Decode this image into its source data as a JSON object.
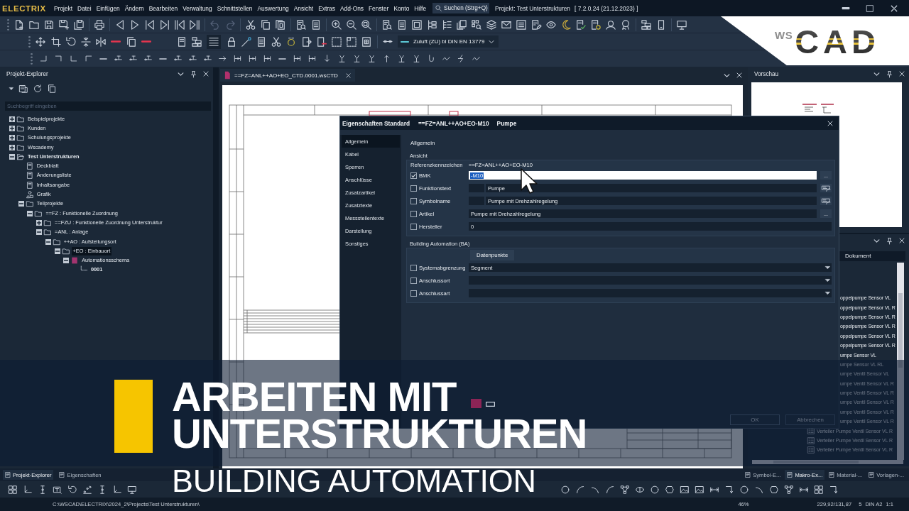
{
  "app": {
    "logo": "ELECTRIX",
    "menu": [
      "Projekt",
      "Datei",
      "Einfügen",
      "Ändern",
      "Bearbeiten",
      "Verwaltung",
      "Schnittstellen",
      "Auswertung",
      "Ansicht",
      "Extras",
      "Add-Ons",
      "Fenster",
      "Konto",
      "Hilfe"
    ],
    "search": {
      "placeholder": "Suchen (Strg+Q)"
    },
    "project_title": "Projekt: Test Unterstrukturen",
    "version": "[ 7.2.0.24 (21.12.2023) ]"
  },
  "toolbar": {
    "history": [
      {
        "kind": "undo",
        "disabled": true
      },
      {
        "kind": "redo",
        "disabled": true
      }
    ],
    "line_view": {
      "pressed": true
    },
    "medium": "Zuluft (ZU) bl DIN EN 13779"
  },
  "brand_logo": {
    "prefix": "WS",
    "wordmark": "CAD"
  },
  "explorer": {
    "title": "Projekt-Explorer",
    "search": {
      "placeholder": "Suchbegriff eingeben"
    },
    "tree": [
      {
        "label": "Beispielprojekte",
        "kind": "folder",
        "expanded": false,
        "selected": false,
        "active": false
      },
      {
        "label": "Kunden",
        "kind": "folder",
        "expanded": false,
        "selected": false,
        "active": false
      },
      {
        "label": "Schulungsprojekte",
        "kind": "folder",
        "expanded": false,
        "selected": false,
        "active": false
      },
      {
        "label": "Wscademy",
        "kind": "folder",
        "expanded": false,
        "selected": false,
        "active": false
      },
      {
        "label": "Test Unterstrukturen",
        "kind": "project",
        "expanded": true,
        "selected": false,
        "active": true,
        "children": [
          {
            "label": "Deckblatt",
            "kind": "page",
            "selected": false,
            "active": false
          },
          {
            "label": "Änderungsliste",
            "kind": "page",
            "selected": false,
            "active": false
          },
          {
            "label": "Inhaltsangabe",
            "kind": "page",
            "selected": false,
            "active": false
          },
          {
            "label": "Grafik",
            "kind": "graphic",
            "selected": false,
            "active": false
          },
          {
            "label": "Teilprojekte",
            "kind": "folder",
            "expanded": true,
            "selected": false,
            "active": false,
            "children": [
              {
                "label": "==FZ : Funktionelle Zuordnung",
                "kind": "folder",
                "expanded": true,
                "selected": false,
                "active": false,
                "children": [
                  {
                    "label": "==FZU : Funktionelle Zuordnung Unterstruktur",
                    "kind": "folder",
                    "expanded": false,
                    "selected": false,
                    "active": false
                  },
                  {
                    "label": "=ANL : Anlage",
                    "kind": "folder",
                    "expanded": true,
                    "selected": false,
                    "active": false,
                    "children": [
                      {
                        "label": "++AO : Aufstellungsort",
                        "kind": "folder",
                        "expanded": true,
                        "selected": false,
                        "active": false,
                        "children": [
                          {
                            "label": "+EO : Einbauort",
                            "kind": "folder",
                            "expanded": true,
                            "selected": true,
                            "active": false,
                            "children": [
                              {
                                "label": "Automationsschema",
                                "kind": "schema",
                                "expanded": true,
                                "selected": false,
                                "active": false,
                                "children": [
                                  {
                                    "label": "0001",
                                    "kind": "sheet",
                                    "selected": false,
                                    "active": true
                                  }
                                ]
                              }
                            ]
                          }
                        ]
                      }
                    ]
                  }
                ]
              }
            ]
          }
        ]
      }
    ]
  },
  "document": {
    "tab": "==FZ=ANL++AO+EO_CTD.0001.wsCTD"
  },
  "preview": {
    "title": "Vorschau"
  },
  "macro_panel": {
    "column": "Dokument",
    "items": [
      {
        "kind": "bare",
        "label": "oppelpumpe Sensor VL"
      },
      {
        "kind": "bare",
        "label": "oppelpumpe Sensor VL R"
      },
      {
        "kind": "bare",
        "label": "oppelpumpe Sensor VL R"
      },
      {
        "kind": "bare",
        "label": "oppelpumpe Sensor VL R"
      },
      {
        "kind": "bare",
        "label": "oppelpumpe Sensor VL R"
      },
      {
        "kind": "bare",
        "label": "oppelpumpe Sensor VL R"
      },
      {
        "kind": "bare",
        "label": "umpe Sensor VL"
      },
      {
        "kind": "bare",
        "label": "umpe Sensor VL RL"
      },
      {
        "kind": "bare",
        "label": "umpe Ventil Sensor VL"
      },
      {
        "kind": "bare",
        "label": "umpe Ventil Sensor VL R"
      },
      {
        "kind": "bare",
        "label": "umpe Ventil Sensor VL R"
      },
      {
        "kind": "bare",
        "label": "umpe Ventil Sensor VL R"
      },
      {
        "kind": "bare",
        "label": "umpe Ventil Sensor VL R"
      },
      {
        "kind": "bare",
        "label": "umpe Ventil Sensor VL R"
      },
      {
        "kind": "icon",
        "label": "Verteiler Pumpe Ventil Sensor VL R"
      },
      {
        "kind": "icon",
        "label": "Verteiler Pumpe Ventil Sensor VL R"
      },
      {
        "kind": "icon",
        "label": "Verteiler Pumpe Ventil Sensor VL R"
      }
    ]
  },
  "dialog": {
    "title": "Eigenschaften Standard",
    "reference": "==FZ=ANL++AO+EO-M10",
    "name": "Pumpe",
    "nav": [
      {
        "label": "Allgemein",
        "selected": true
      },
      {
        "label": "Kabel",
        "selected": false
      },
      {
        "label": "Sperren",
        "selected": false
      },
      {
        "label": "Anschlüsse",
        "selected": false
      },
      {
        "label": "Zusatzartikel",
        "selected": false
      },
      {
        "label": "Zusatztexte",
        "selected": false
      },
      {
        "label": "Messstellentexte",
        "selected": false
      },
      {
        "label": "Darstellung",
        "selected": false
      },
      {
        "label": "Sonstiges",
        "selected": false
      }
    ],
    "heading": "Allgemein",
    "groups": [
      {
        "title": "Ansicht",
        "reference": {
          "label": "Referenzkennzeichen",
          "value": "==FZ=ANL++AO+EO-M10"
        },
        "fields": [
          {
            "kind": "browse",
            "label": "BMK",
            "checked": true,
            "focused": true,
            "value": "-M10",
            "button": "..."
          },
          {
            "kind": "format",
            "label": "Funktionstext",
            "checked": false,
            "focused": false,
            "value": "Pumpe"
          },
          {
            "kind": "format",
            "label": "Symbolname",
            "checked": false,
            "focused": false,
            "value": "Pumpe mit Drehzahlregelung"
          },
          {
            "kind": "browse",
            "label": "Artikel",
            "checked": false,
            "focused": false,
            "value": "Pumpe mit Drehzahlregelung",
            "button": "..."
          },
          {
            "kind": "plain",
            "label": "Hersteller",
            "checked": false,
            "focused": false,
            "value": "0"
          }
        ]
      },
      {
        "title": "Building Automation (BA)",
        "action": "Datenpunkte",
        "fields": [
          {
            "kind": "select",
            "label": "Systemabgrenzung",
            "checked": false,
            "focused": false,
            "value": "Segment"
          },
          {
            "kind": "select",
            "label": "Anschlussort",
            "checked": false,
            "focused": false
          },
          {
            "kind": "select",
            "label": "Anschlussart",
            "checked": false,
            "focused": false
          }
        ]
      }
    ],
    "buttons": [
      {
        "label": "OK"
      },
      {
        "label": "Abbrechen"
      }
    ]
  },
  "bottom_tabs": {
    "left": [
      {
        "label": "Projekt-Explorer",
        "selected": true
      },
      {
        "label": "Eigenschaften",
        "selected": false
      }
    ],
    "right": [
      {
        "label": "Symbol-E...",
        "selected": false
      },
      {
        "label": "Makro-Ex...",
        "selected": true
      },
      {
        "label": "Material-...",
        "selected": false
      },
      {
        "label": "Vorlagen-...",
        "selected": false
      }
    ]
  },
  "status_bar": {
    "path": "C:\\WSCAD\\ELECTRIX\\2024_2\\Projects\\Test Unterstrukturen\\",
    "zoom": "46%",
    "coordinates": "229,92/131,87",
    "sheet": "5",
    "format": "DIN A2",
    "scale": "1:1"
  },
  "banner": {
    "title_lines": [
      "ARBEITEN MIT",
      "UNTERSTRUKTUREN"
    ],
    "subtitle": "BUILDING AUTOMATION"
  }
}
